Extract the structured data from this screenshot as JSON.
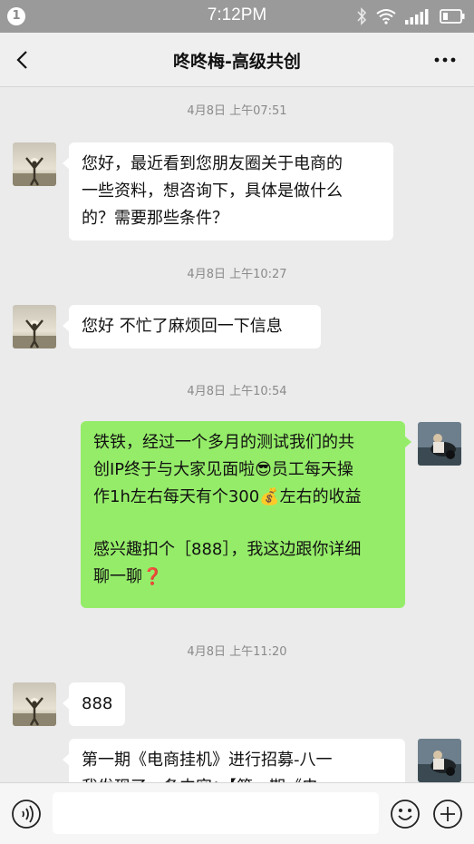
{
  "status_bar": {
    "notification_count": "1",
    "time": "7:12PM"
  },
  "header": {
    "title": "咚咚梅-高级共创"
  },
  "messages": [
    {
      "timestamp": "4月8日 上午07:51"
    },
    {
      "side": "left",
      "lines": [
        "您好，最近看到您朋友圈关于电商的",
        "一些资料，想咨询下，具体是做什么",
        "的？需要那些条件？"
      ]
    },
    {
      "timestamp": "4月8日 上午10:27"
    },
    {
      "side": "left",
      "lines": [
        "您好 不忙了麻烦回一下信息"
      ]
    },
    {
      "timestamp": "4月8日 上午10:54"
    },
    {
      "side": "right",
      "lines": [
        "铁铁，经过一个多月的测试我们的共",
        "创IP终于与大家见面啦😎员工每天操",
        "作1h左右每天有个300💰左右的收益",
        "",
        "感兴趣扣个［888］，我这边跟你详细",
        "聊一聊❓"
      ]
    },
    {
      "timestamp": "4月8日 上午11:20"
    },
    {
      "side": "left",
      "lines": [
        "888"
      ]
    },
    {
      "side": "right-white",
      "lines": [
        "第一期《电商挂机》进行招募-八一",
        "我发现了一条内容：【第一期《电"
      ]
    }
  ],
  "colors": {
    "status_bar": "#9a9a9a",
    "chat_bg": "#ebebeb",
    "bubble_right": "#95ec69",
    "bubble_left": "#ffffff"
  },
  "icons": {
    "back": "chevron-left-icon",
    "more": "more-dots-icon",
    "voice": "voice-icon",
    "emoji": "emoji-icon",
    "plus": "plus-icon"
  }
}
